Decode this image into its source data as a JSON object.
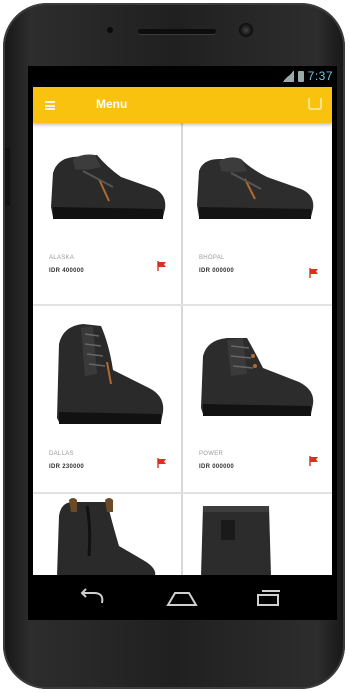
{
  "app": {
    "title": "Menu"
  },
  "status": {
    "time": "7:37"
  },
  "colors": {
    "accent": "#f8c20f",
    "flag": "#d9301f",
    "time": "#6ec6e8"
  },
  "icons": {
    "menu": "hamburger-icon",
    "cart": "cart-icon",
    "wishlist": "flag-icon"
  },
  "products": [
    {
      "name": "ALASKA",
      "price": "IDR 400000"
    },
    {
      "name": "BHOPAL",
      "price": "IDR 000000"
    },
    {
      "name": "DALLAS",
      "price": "IDR 230000"
    },
    {
      "name": "POWER",
      "price": "IDR 000000"
    },
    {
      "name": "",
      "price": ""
    },
    {
      "name": "",
      "price": ""
    }
  ],
  "navigation": [
    "back",
    "home",
    "recent-apps"
  ]
}
